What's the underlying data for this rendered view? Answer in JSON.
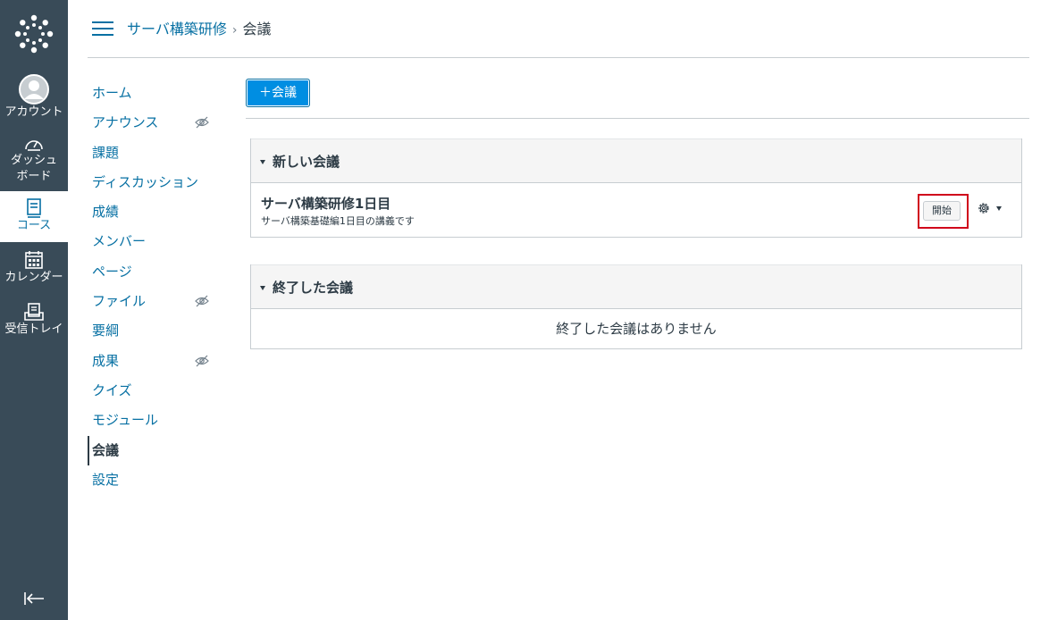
{
  "global_nav": {
    "items": [
      {
        "label": "アカウント",
        "icon": "avatar-icon"
      },
      {
        "label": "ダッシュ\nボード",
        "icon": "dashboard-icon"
      },
      {
        "label": "コース",
        "icon": "courses-icon",
        "active": true
      },
      {
        "label": "カレンダー",
        "icon": "calendar-icon"
      },
      {
        "label": "受信トレイ",
        "icon": "inbox-icon"
      }
    ]
  },
  "header": {
    "breadcrumb_course": "サーバ構築研修",
    "breadcrumb_current": "会議"
  },
  "course_nav": {
    "items": [
      {
        "label": "ホーム"
      },
      {
        "label": "アナウンス",
        "hidden": true
      },
      {
        "label": "課題"
      },
      {
        "label": "ディスカッション"
      },
      {
        "label": "成績"
      },
      {
        "label": "メンバー"
      },
      {
        "label": "ページ"
      },
      {
        "label": "ファイル",
        "hidden": true
      },
      {
        "label": "要綱"
      },
      {
        "label": "成果",
        "hidden": true
      },
      {
        "label": "クイズ"
      },
      {
        "label": "モジュール"
      },
      {
        "label": "会議",
        "active": true
      },
      {
        "label": "設定"
      }
    ]
  },
  "toolbar": {
    "add_conference_label": "＋会議"
  },
  "new_conferences": {
    "heading": "新しい会議",
    "items": [
      {
        "title": "サーバ構築研修1日目",
        "description": "サーバ構築基礎編1日目の講義です",
        "start_label": "開始"
      }
    ]
  },
  "concluded_conferences": {
    "heading": "終了した会議",
    "empty_message": "終了した会議はありません"
  },
  "colors": {
    "nav_bg": "#394b58",
    "link": "#0770a3",
    "primary_button": "#008ee2",
    "highlight": "#d0021b"
  }
}
